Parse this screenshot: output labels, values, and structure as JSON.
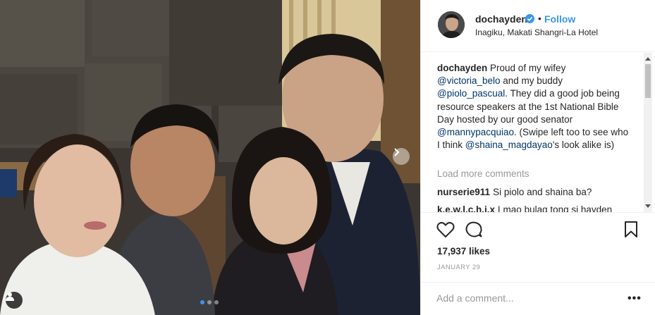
{
  "post": {
    "username": "dochayden",
    "follow_label": "Follow",
    "separator": "•",
    "location": "Inagiku, Makati Shangri-La Hotel",
    "caption": {
      "parts": [
        {
          "text": "Proud of my wifey ",
          "mention": false
        },
        {
          "text": "@victoria_belo",
          "mention": true
        },
        {
          "text": " and my buddy ",
          "mention": false
        },
        {
          "text": "@piolo_pascual",
          "mention": true
        },
        {
          "text": ". They did a good job being resource speakers at the 1st National Bible Day hosted by our good senator ",
          "mention": false
        },
        {
          "text": "@mannypacquiao",
          "mention": true
        },
        {
          "text": ". (Swipe left too to see who I think ",
          "mention": false
        },
        {
          "text": "@shaina_magdayao",
          "mention": true
        },
        {
          "text": "'s look alike is)",
          "mention": false
        }
      ]
    },
    "load_more_label": "Load more comments",
    "comments": [
      {
        "user": "nurserie911",
        "text": "Si piolo and shaina ba?"
      },
      {
        "user": "k.e.w.l.c.h.i.x",
        "text": "Lmao bulag tong si hayden"
      }
    ],
    "likes": "17,937 likes",
    "date": "JANUARY 29",
    "comment_placeholder": "Add a comment...",
    "more_options": "•••"
  },
  "carousel": {
    "slide_count": 3,
    "active_index": 0
  },
  "icons": {
    "verified": "verified-badge-icon",
    "like": "heart-icon",
    "comment": "comment-bubble-icon",
    "save": "bookmark-icon",
    "next": "chevron-right-icon",
    "tag": "user-tag-icon"
  },
  "colors": {
    "accent": "#3897f0",
    "mention": "#003569",
    "muted": "#999999",
    "text": "#262626",
    "border": "#efefef"
  }
}
